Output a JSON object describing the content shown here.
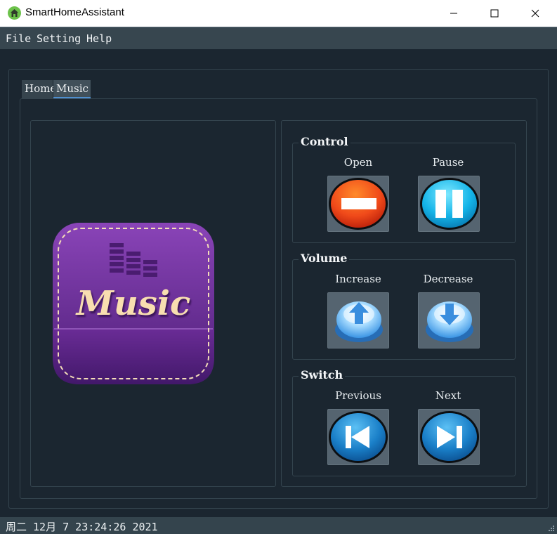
{
  "window": {
    "title": "SmartHomeAssistant",
    "icon": "home-icon"
  },
  "menu": {
    "items": [
      "File",
      "Setting",
      "Help"
    ]
  },
  "tabs": [
    {
      "label": "Home",
      "selected": false
    },
    {
      "label": "Music",
      "selected": true
    }
  ],
  "album_art": {
    "text": "Music"
  },
  "groups": {
    "control": {
      "title": "Control",
      "buttons": [
        {
          "label": "Open",
          "icon": "stop-icon"
        },
        {
          "label": "Pause",
          "icon": "pause-icon"
        }
      ]
    },
    "volume": {
      "title": "Volume",
      "buttons": [
        {
          "label": "Increase",
          "icon": "arrow-up-icon"
        },
        {
          "label": "Decrease",
          "icon": "arrow-down-icon"
        }
      ]
    },
    "switch": {
      "title": "Switch",
      "buttons": [
        {
          "label": "Previous",
          "icon": "skip-previous-icon"
        },
        {
          "label": "Next",
          "icon": "skip-next-icon"
        }
      ]
    }
  },
  "status": {
    "datetime": "周二 12月 7 23:24:26 2021"
  },
  "colors": {
    "background": "#1b2630",
    "menubar": "#37464f",
    "open_button": "#f04a1a",
    "pause_button": "#14b4e8",
    "volume_button": "#5cb4f0",
    "switch_button": "#1a7fc8",
    "album_purple": "#6a2a98",
    "album_text": "#f8deb0"
  }
}
